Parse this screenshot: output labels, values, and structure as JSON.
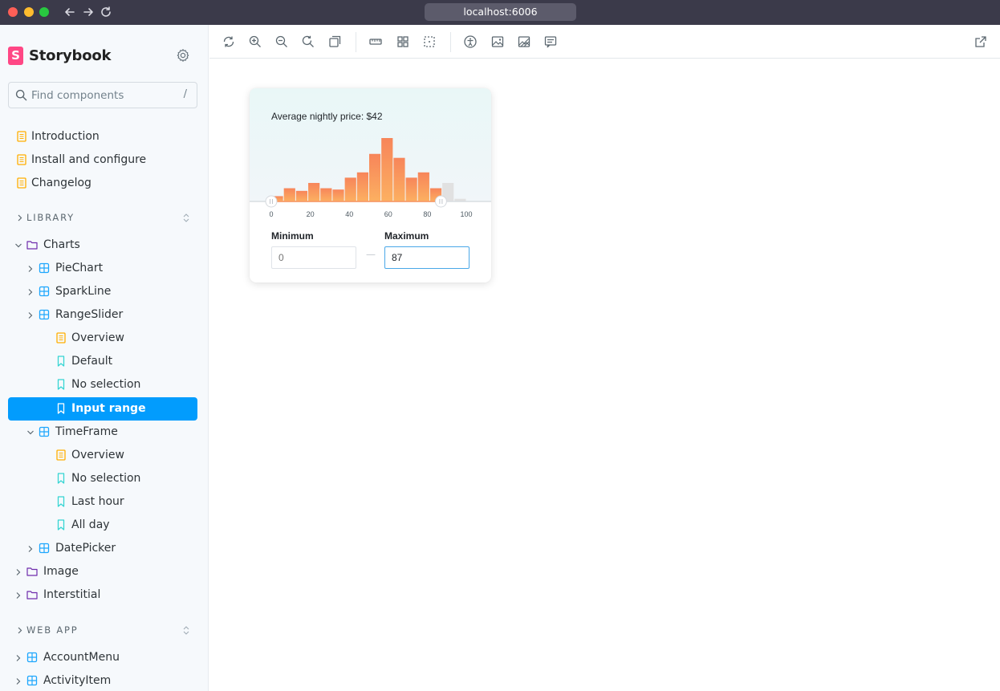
{
  "browser": {
    "url": "localhost:6006"
  },
  "sidebar": {
    "brand": "Storybook",
    "brand_logo_letter": "S",
    "search": {
      "placeholder": "Find components",
      "shortcut": "/"
    },
    "docs": [
      {
        "label": "Introduction",
        "icon": "document-icon"
      },
      {
        "label": "Install and configure",
        "icon": "document-icon"
      },
      {
        "label": "Changelog",
        "icon": "document-icon"
      }
    ],
    "sections": {
      "library": "LIBRARY",
      "webapp": "WEB APP"
    },
    "tree": {
      "charts": "Charts",
      "piechart": "PieChart",
      "sparkline": "SparkLine",
      "rangeslider": "RangeSlider",
      "rs_overview": "Overview",
      "rs_default": "Default",
      "rs_noselection": "No selection",
      "rs_inputrange": "Input range",
      "timeframe": "TimeFrame",
      "tf_overview": "Overview",
      "tf_noselection": "No selection",
      "tf_lasthour": "Last hour",
      "tf_allday": "All day",
      "datepicker": "DatePicker",
      "image": "Image",
      "interstitial": "Interstitial",
      "accountmenu": "AccountMenu",
      "activityitem": "ActivityItem"
    }
  },
  "colors": {
    "accent": "#029cfd",
    "brand": "#ff4785",
    "doc_icon": "#ffae00",
    "component_icon": "#1ea7fd",
    "story_icon": "#37d5d3",
    "folder_icon": "#6f2cac",
    "bar_active": "#fc9156",
    "bar_inactive": "#e1e1e1"
  },
  "canvas": {
    "title": "Average nightly price: $42",
    "minimum_label": "Minimum",
    "maximum_label": "Maximum",
    "minimum_value": "",
    "minimum_placeholder": "0",
    "maximum_value": "87",
    "separator": "—"
  },
  "chart_data": {
    "type": "bar",
    "title": "Average nightly price: $42",
    "xlabel": "",
    "ylabel": "",
    "x_ticks": [
      0,
      20,
      40,
      60,
      80,
      100
    ],
    "xlim": [
      0,
      100
    ],
    "bin_width": 6.25,
    "bin_starts": [
      0,
      6.25,
      12.5,
      18.75,
      25,
      31.25,
      37.5,
      43.75,
      50,
      56.25,
      62.5,
      68.75,
      75,
      81.25,
      87.5,
      93.75
    ],
    "values": [
      2,
      5,
      4,
      7,
      5,
      4.5,
      9,
      11,
      18,
      24,
      16.5,
      9,
      11,
      5,
      7,
      1
    ],
    "selection": {
      "min": 0,
      "max": 87
    },
    "grid": false
  }
}
